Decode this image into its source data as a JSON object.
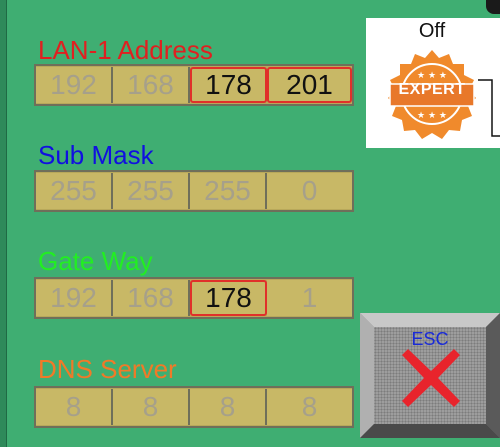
{
  "lan1": {
    "label": "LAN-1 Address",
    "label_color": "#e02020",
    "octets": [
      "192",
      "168",
      "178",
      "201"
    ]
  },
  "subnet": {
    "label": "Sub Mask",
    "label_color": "#1010e0",
    "octets": [
      "255",
      "255",
      "255",
      "0"
    ]
  },
  "gateway": {
    "label": "Gate Way",
    "label_color": "#22ee22",
    "octets": [
      "192",
      "168",
      "178",
      "1"
    ]
  },
  "dns": {
    "label": "DNS Server",
    "label_color": "#f07a28",
    "octets": [
      "8",
      "8",
      "8",
      "8"
    ]
  },
  "expert_mode": {
    "state": "Off",
    "badge_text": "EXPERT",
    "badge_color": "#f08a2c"
  },
  "esc_button": {
    "label": "ESC",
    "icon": "close-x-icon",
    "icon_color": "#e8242c"
  }
}
